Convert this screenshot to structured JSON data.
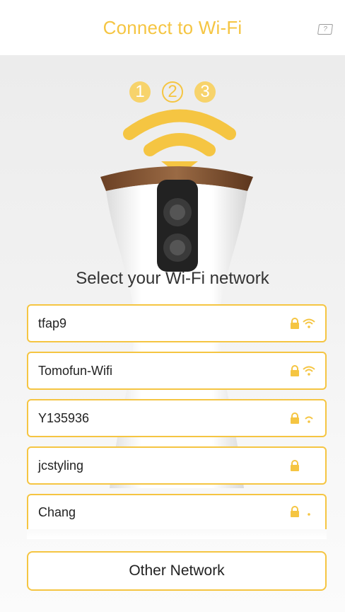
{
  "header": {
    "title": "Connect to Wi-Fi",
    "help_icon": "?"
  },
  "steps": [
    "1",
    "2",
    "3"
  ],
  "current_step": 2,
  "prompt": "Select your Wi-Fi network",
  "networks": [
    {
      "name": "tfap9",
      "secured": true,
      "signal": "full"
    },
    {
      "name": "Tomofun-Wifi",
      "secured": true,
      "signal": "full"
    },
    {
      "name": "Y135936",
      "secured": true,
      "signal": "medium"
    },
    {
      "name": "jcstyling",
      "secured": true,
      "signal": "none"
    },
    {
      "name": "Chang",
      "secured": true,
      "signal": "weak"
    }
  ],
  "other_button": "Other Network",
  "colors": {
    "accent": "#f5c542",
    "step_light": "#f7d36b"
  }
}
